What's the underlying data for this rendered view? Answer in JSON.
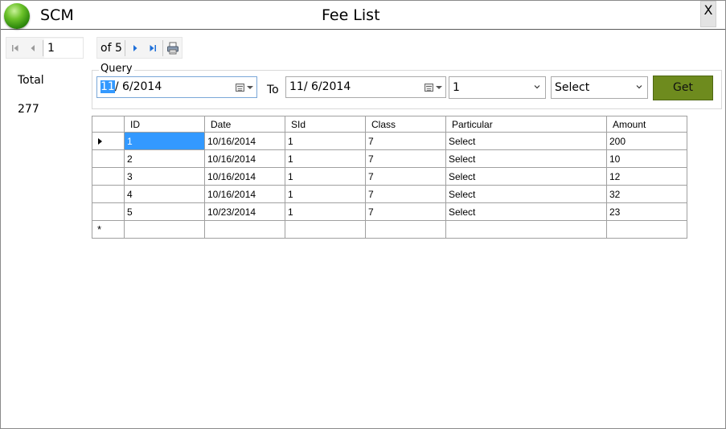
{
  "window": {
    "app_name": "SCM",
    "title": "Fee List",
    "close_label": "X"
  },
  "navigator": {
    "position": "1",
    "of_text": "of 5",
    "icons": [
      "first-icon",
      "previous-icon",
      "next-icon",
      "last-icon",
      "print-icon"
    ]
  },
  "summary": {
    "total_label": "Total",
    "total_value": "277"
  },
  "query": {
    "legend": "Query",
    "from_date_selected": "11",
    "from_date_rest": "/  6/2014",
    "to_label": "To",
    "to_date": "11/  6/2014",
    "class_value": "1",
    "particular_value": "Select",
    "get_label": "Get"
  },
  "grid": {
    "columns": [
      "ID",
      "Date",
      "SId",
      "Class",
      "Particular",
      "Amount"
    ],
    "rows": [
      [
        "1",
        "10/16/2014",
        "1",
        "7",
        "Select",
        "200"
      ],
      [
        "2",
        "10/16/2014",
        "1",
        "7",
        "Select",
        "10"
      ],
      [
        "3",
        "10/16/2014",
        "1",
        "7",
        "Select",
        "12"
      ],
      [
        "4",
        "10/16/2014",
        "1",
        "7",
        "Select",
        "32"
      ],
      [
        "5",
        "10/23/2014",
        "1",
        "7",
        "Select",
        "23"
      ]
    ],
    "new_row_marker": "*"
  },
  "colors": {
    "accent_selection": "#3399ff",
    "get_button": "#6e8b1e",
    "nav_blue": "#1e6fd9"
  }
}
